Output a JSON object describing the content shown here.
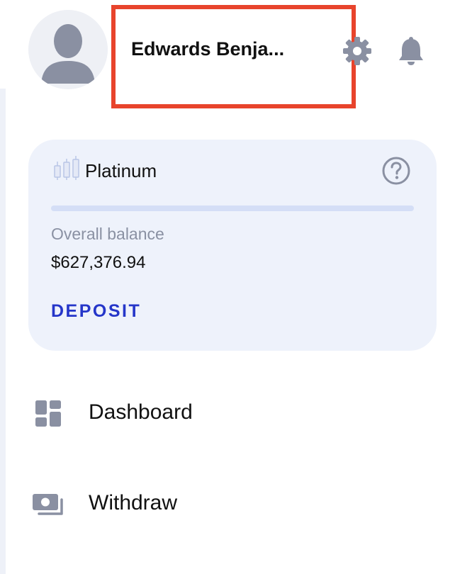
{
  "header": {
    "user_name": "Edwards Benja...",
    "avatar_icon": "user-placeholder-icon",
    "settings_icon": "gear-icon",
    "notifications_icon": "bell-icon"
  },
  "account": {
    "tier_icon": "candlestick-chart-icon",
    "tier_name": "Platinum",
    "help_icon": "question-circle-icon",
    "progress_fraction": 1.0,
    "balance_label": "Overall balance",
    "balance_value": "$627,376.94",
    "deposit_label": "DEPOSIT"
  },
  "nav": {
    "items": [
      {
        "label": "Dashboard",
        "icon": "dashboard-grid-icon"
      },
      {
        "label": "Withdraw",
        "icon": "cash-stack-icon"
      }
    ]
  },
  "colors": {
    "accent": "#2536c9",
    "highlight_box": "#e8442c",
    "card_background": "#eef2fb",
    "icon_gray": "#8a90a2"
  }
}
